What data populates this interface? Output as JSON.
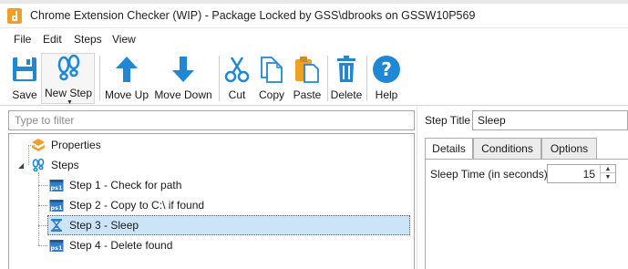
{
  "window": {
    "title": "Chrome Extension Checker (WIP) - Package Locked by GSS\\dbrooks on GSSW10P569"
  },
  "menu": [
    "File",
    "Edit",
    "Steps",
    "View"
  ],
  "toolbar": {
    "save": "Save",
    "new_step": "New Step",
    "move_up": "Move Up",
    "move_down": "Move Down",
    "cut": "Cut",
    "copy": "Copy",
    "paste": "Paste",
    "delete": "Delete",
    "help": "Help"
  },
  "filter": {
    "placeholder": "Type to filter",
    "value": ""
  },
  "tree": {
    "properties": "Properties",
    "steps": "Steps",
    "items": [
      {
        "label": "Step 1 - Check for path",
        "icon": "powershell-icon"
      },
      {
        "label": "Step 2 - Copy to C:\\ if found",
        "icon": "powershell-icon"
      },
      {
        "label": "Step 3 - Sleep",
        "icon": "hourglass-icon"
      },
      {
        "label": "Step 4 - Delete found",
        "icon": "powershell-icon"
      }
    ],
    "selected_index": 2
  },
  "step_title": {
    "label": "Step Title",
    "value": "Sleep"
  },
  "tabs": [
    "Details",
    "Conditions",
    "Options"
  ],
  "active_tab": "Details",
  "details": {
    "sleep_label": "Sleep Time (in seconds)",
    "sleep_value": "15"
  },
  "colors": {
    "accent_blue": "#1e88d6",
    "selection": "#cce4f7",
    "orange": "#f0a028",
    "ps_blue": "#2f7fc8"
  }
}
